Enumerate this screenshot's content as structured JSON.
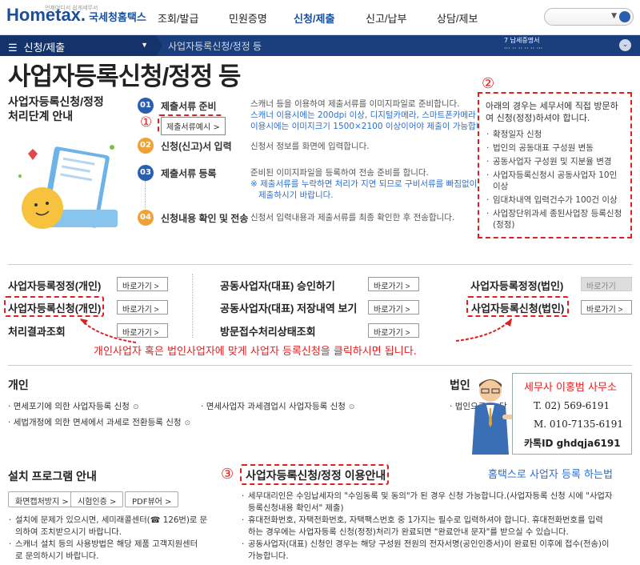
{
  "header": {
    "logo_small": "언제어디서 쉽게세무서",
    "logo": "Hometax.",
    "logo_kr": "국세청홈택스",
    "nav": [
      "조회/발급",
      "민원증명",
      "신청/제출",
      "신고/납부",
      "상담/제보"
    ],
    "nav_active": 2
  },
  "bluebar": {
    "menu": "신청/제출",
    "crumb": "사업자등록신청/정정 등",
    "right_line1": "7 납세증명서",
    "right_line2": "··· ·· ·· ·· ·· ···"
  },
  "page_title": "사업자등록신청/정정 등",
  "process": {
    "title_l1": "사업자등록신청/정정",
    "title_l2": "처리단계 안내",
    "steps": [
      {
        "num": "01",
        "label": "제출서류 준비",
        "desc1": "스캐너 등을 이용하여 제출서류를 이미지파일로 준비합니다.",
        "desc2": "스캐너 이용시에는 200dpi 이상, 디지털카메라, 스마트폰카메라 등",
        "desc3": "이용시에는 이미지크기 1500×2100 이상이어야 제출이 가능합니다.",
        "color": "#2a5fb0"
      },
      {
        "num": "02",
        "label": "신청(신고)서 입력",
        "desc1": "신청서 정보를 화면에 입력합니다.",
        "color": "#f0a23a"
      },
      {
        "num": "03",
        "label": "제출서류 등록",
        "desc1": "준비된 이미지파일을 등록하여 전송 준비를 합니다.",
        "desc2": "※ 제출서류를 누락하면 처리가 지연 되므로 구비서류를 빠짐없이",
        "desc3": "제출하시기 바랍니다.",
        "color": "#2a5fb0"
      },
      {
        "num": "04",
        "label": "신청내용 확인 및 전송",
        "desc1": "신청서 입력내용과 제출서류를 최종 확인한 후 전송합니다.",
        "color": "#f0a23a"
      }
    ],
    "sample_btn": "제출서류예시 >"
  },
  "annot": {
    "n1": "①",
    "n2": "②",
    "n3": "③",
    "main_msg": "개인사업자 혹은 법인사업자에 맞게 사업자 등록신청을 클릭하시면 됩니다.",
    "caption": "홈택스로 사업자 등록 하는법"
  },
  "infobox": {
    "intro": "아래의 경우는 세무서에 직접 방문하여 신청(정정)하셔야 합니다.",
    "items": [
      "확정일자 신청",
      "법인의 공동대표 구성원 변동",
      "공동사업자 구성원 및 지분율 변경",
      "사업자등록신청시 공동사업자 10인 이상",
      "임대차내역 입력건수가 100건 이상",
      "사업장단위과세 종된사업장 등록신청(정정)"
    ]
  },
  "links": {
    "go": "바로가기 >",
    "go_disabled": "바로가기",
    "col1": [
      "사업자등록정정(개인)",
      "사업자등록신청(개인)",
      "처리결과조회"
    ],
    "col2": [
      "공동사업자(대표) 승인하기",
      "공동사업자(대표) 저장내역 보기",
      "방문접수처리상태조회"
    ],
    "col3": [
      "사업자등록정정(법인)",
      "사업자등록신청(법인)"
    ]
  },
  "individual": {
    "title": "개인",
    "items": [
      "면세포기에 의한 사업자등록 신청",
      "면세사업자 과세겸업시 사업자등록 신청",
      "세법개정에 의한 면세에서 과세로 전환등록 신청"
    ]
  },
  "corporate": {
    "title": "법인",
    "items": [
      "법인으로 ··· 단"
    ]
  },
  "card": {
    "title": "세무사 이홍범 사무소",
    "tel": "T. 02) 569-6191",
    "mobile": "M. 010-7135-6191",
    "kakao": "카톡ID ghdqja6191"
  },
  "install": {
    "title": "설치 프로그램 안내",
    "buttons": [
      "화면캡처방지 >",
      "시험인증 >",
      "PDF뷰어 >"
    ],
    "notes": [
      "설치에 문제가 있으시면, 세미래콜센터(☎ 126번)로 문",
      "의하여 조치받으시기 바랍니다.",
      "스캐너 설치 등의 사용방법은 해당 제품 고객지원센터",
      "로 문의하시기 바랍니다."
    ]
  },
  "usage": {
    "title": "사업자등록신청/정정 이용안내",
    "lines": [
      "세무대리인은 수임납세자의 \"수임동록 및 동의\"가 된 경우 신청 가능합니다.(사업자등록 신청 시에 \"사업자",
      "등록신청내용 확인서\" 제출)",
      "휴대전화번호, 자택전화번호, 자택팩스번호 중 1가지는 필수로 입력하셔야 합니다. 휴대전화번호를 입력",
      "하는 경우에는 사업자등록 신청(정정)처리가 완료되면 \"완료안내 문자\"를 받으실 수 있습니다.",
      "공동사업자(대표) 신청인 경우는 해당 구성원 전원의 전자서명(공인인증서)이 완료된 이후에 접수(전송)이",
      "가능합니다."
    ]
  }
}
